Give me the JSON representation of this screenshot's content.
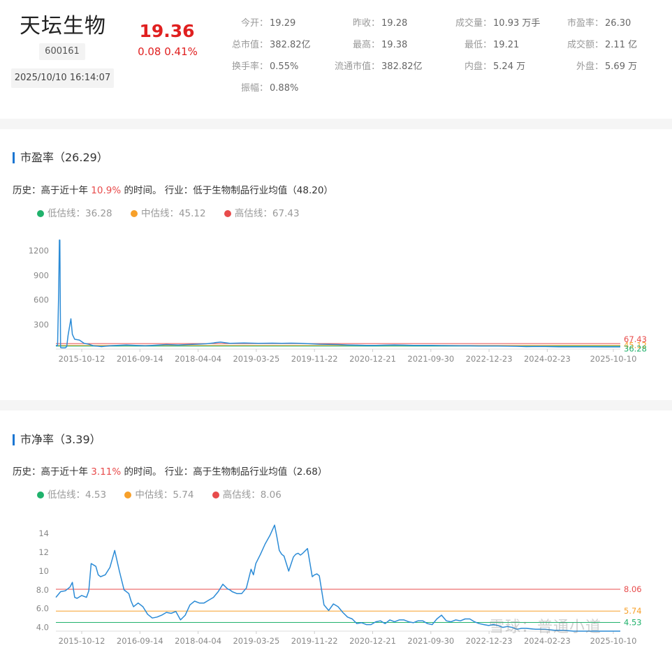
{
  "stock": {
    "name": "天坛生物",
    "code": "600161",
    "datetime": "2025/10/10 16:14:07",
    "price": "19.36",
    "change": "0.08 0.41%"
  },
  "quote_labels": [
    "今开",
    "昨收",
    "成交量",
    "市盈率",
    "总市值",
    "最高",
    "最低",
    "成交额",
    "换手率",
    "流通市值",
    "内盘",
    "外盘",
    "振幅"
  ],
  "quote_values": [
    "19.29",
    "19.28",
    "10.93 万手",
    "26.30",
    "382.82亿",
    "19.38",
    "19.21",
    "2.11 亿",
    "0.55%",
    "382.82亿",
    "5.24 万",
    "5.69 万",
    "0.88%"
  ],
  "pe": {
    "title": "市盈率（26.29）",
    "history_prefix": "历史：高于近十年 ",
    "history_pct": "10.9%",
    "history_suffix": " 的时间。 行业：低于生物制品行业均值（48.20）",
    "legend": [
      {
        "label": "低估线：36.28",
        "color": "#20b26c"
      },
      {
        "label": "中估线：45.12",
        "color": "#f7a02a"
      },
      {
        "label": "高估线：67.43",
        "color": "#e84b4b"
      }
    ]
  },
  "pb": {
    "title": "市净率（3.39）",
    "history_prefix": "历史：高于近十年 ",
    "history_pct": "3.11%",
    "history_suffix": " 的时间。 行业：高于生物制品行业均值（2.68）",
    "legend": [
      {
        "label": "低估线：4.53",
        "color": "#20b26c"
      },
      {
        "label": "中估线：5.74",
        "color": "#f7a02a"
      },
      {
        "label": "高估线：8.06",
        "color": "#e84b4b"
      }
    ]
  },
  "chart_data": [
    {
      "type": "line",
      "title": "市盈率（26.29）",
      "x_ticks": [
        "2015-10-12",
        "2016-09-14",
        "2018-04-04",
        "2019-03-25",
        "2019-11-22",
        "2020-12-21",
        "2021-09-30",
        "2022-12-23",
        "2024-02-23",
        "2025-10-10"
      ],
      "y_ticks": [
        "300",
        "600",
        "900",
        "1200"
      ],
      "ylim": [
        0,
        1380
      ],
      "hlines": [
        {
          "value": 67.43,
          "label": "67.43",
          "color": "#e84b4b"
        },
        {
          "value": 45.12,
          "label": "45.12",
          "color": "#f7a02a"
        },
        {
          "value": 36.28,
          "label": "36.28",
          "color": "#20b26c"
        }
      ],
      "series": [
        {
          "color": "#2b8bd6",
          "x": [
            0,
            0.35,
            0.6,
            0.75,
            0.85,
            0.92,
            1.0,
            1.2,
            1.8,
            2.0,
            2.3,
            2.6,
            3.2,
            3.5,
            4.0,
            5.0,
            6.0,
            7.0,
            8.0,
            9.0,
            9.7,
            10.5,
            11.5,
            13.0,
            15.0,
            17.0,
            19.0,
            20.5,
            22.0,
            23.5,
            26.0,
            28.0,
            30.0,
            32.0,
            33.5,
            34.0,
            35.0,
            37.0,
            40.0,
            43.0,
            46.0,
            48.0,
            50.0,
            52.0,
            54.0,
            56.0,
            58.0,
            60.0,
            62.0,
            64.0,
            66.0,
            68.0,
            70.0,
            72.0,
            74.0,
            76.0,
            78.0,
            80.0,
            82.0,
            84.0,
            86.0,
            88.0,
            90.0,
            92.0,
            94.0,
            96.0,
            98.0,
            100.0,
            103.0,
            107.0,
            110.0,
            113.0,
            117.0,
            120.0
          ],
          "values": [
            45,
            40,
            700,
            1330,
            1330,
            700,
            20,
            15,
            15,
            15,
            30,
            170,
            370,
            180,
            120,
            110,
            70,
            60,
            40,
            35,
            30,
            35,
            40,
            45,
            50,
            45,
            40,
            45,
            50,
            55,
            50,
            55,
            60,
            65,
            75,
            80,
            85,
            70,
            75,
            70,
            72,
            70,
            72,
            70,
            65,
            60,
            58,
            55,
            50,
            48,
            45,
            45,
            48,
            50,
            48,
            45,
            45,
            45,
            43,
            42,
            40,
            40,
            38,
            38,
            38,
            36,
            34,
            30,
            32,
            28,
            28,
            27,
            26,
            26
          ]
        }
      ]
    },
    {
      "type": "line",
      "title": "市净率（3.39）",
      "x_ticks": [
        "2015-10-12",
        "2016-09-14",
        "2018-04-04",
        "2019-03-25",
        "2019-11-22",
        "2020-12-21",
        "2021-09-30",
        "2022-12-23",
        "2024-02-23",
        "2025-10-10"
      ],
      "y_ticks": [
        "4.0",
        "6.0",
        "8.0",
        "10",
        "12",
        "14"
      ],
      "ylim": [
        3.6,
        15.8
      ],
      "hlines": [
        {
          "value": 8.06,
          "label": "8.06",
          "color": "#e84b4b"
        },
        {
          "value": 5.74,
          "label": "5.74",
          "color": "#f7a02a"
        },
        {
          "value": 4.53,
          "label": "4.53",
          "color": "#20b26c"
        }
      ],
      "series": [
        {
          "color": "#2b8bd6",
          "x": [
            0,
            1.0,
            2.0,
            3.0,
            3.5,
            4.0,
            4.5,
            5.5,
            6.5,
            7.0,
            7.5,
            8.5,
            9.0,
            9.5,
            10.5,
            11.5,
            12.5,
            13.5,
            14.5,
            15.5,
            16.0,
            16.5,
            17.5,
            18.5,
            19.5,
            20.5,
            21.5,
            22.5,
            23.5,
            24.5,
            25.5,
            26.5,
            27.5,
            28.5,
            29.5,
            30.5,
            31.5,
            32.5,
            33.5,
            34.5,
            35.5,
            36.5,
            37.0,
            37.5,
            38.5,
            39.5,
            40.5,
            41.5,
            42.0,
            42.5,
            43.5,
            44.5,
            45.5,
            46.5,
            47.0,
            47.5,
            48.0,
            48.5,
            49.5,
            50.5,
            51.0,
            51.5,
            52.0,
            52.5,
            53.5,
            54.5,
            55.0,
            55.5,
            56.0,
            57.0,
            58.0,
            59.0,
            60.0,
            61.0,
            62.0,
            63.0,
            64.0,
            65.0,
            66.0,
            67.0,
            68.0,
            69.0,
            70.0,
            71.0,
            72.0,
            73.0,
            74.0,
            75.0,
            76.0,
            77.0,
            78.0,
            79.0,
            80.0,
            81.0,
            82.0,
            83.0,
            84.0,
            85.0,
            86.0,
            87.0,
            88.0,
            89.0,
            90.0,
            91.0,
            92.0,
            93.0,
            94.0,
            95.0,
            96.0,
            97.0,
            98.0,
            99.0,
            100.0,
            102.0,
            104.0,
            106.0,
            108.0,
            110.0,
            112.0,
            114.0,
            116.0,
            118.0,
            120.0
          ],
          "values": [
            7.2,
            7.8,
            7.9,
            8.3,
            8.8,
            7.2,
            7.1,
            7.4,
            7.2,
            7.9,
            10.8,
            10.5,
            9.6,
            9.4,
            9.6,
            10.4,
            12.2,
            10.0,
            8.0,
            7.6,
            6.8,
            6.2,
            6.6,
            6.2,
            5.4,
            5.0,
            5.1,
            5.3,
            5.6,
            5.5,
            5.7,
            4.8,
            5.3,
            6.4,
            6.8,
            6.6,
            6.6,
            6.9,
            7.2,
            7.8,
            8.6,
            8.1,
            8.0,
            7.8,
            7.6,
            7.6,
            8.2,
            10.2,
            9.6,
            10.8,
            11.8,
            12.9,
            13.8,
            14.9,
            13.6,
            12.2,
            11.8,
            11.6,
            10.0,
            11.5,
            11.8,
            11.9,
            11.7,
            11.9,
            12.4,
            9.4,
            9.6,
            9.7,
            9.5,
            6.4,
            5.8,
            6.5,
            6.2,
            5.6,
            5.1,
            4.9,
            4.4,
            4.5,
            4.3,
            4.3,
            4.6,
            4.7,
            4.4,
            4.8,
            4.6,
            4.8,
            4.8,
            4.6,
            4.5,
            4.7,
            4.7,
            4.4,
            4.3,
            4.9,
            5.3,
            4.7,
            4.6,
            4.8,
            4.7,
            4.9,
            4.9,
            4.6,
            4.4,
            4.3,
            4.2,
            4.3,
            4.2,
            4.0,
            4.1,
            4.0,
            3.8,
            3.9,
            3.9,
            3.8,
            3.8,
            3.7,
            3.7,
            3.6,
            3.6,
            3.5,
            3.4,
            3.4,
            3.4
          ]
        }
      ]
    }
  ],
  "watermark": "雪球：普通小道"
}
